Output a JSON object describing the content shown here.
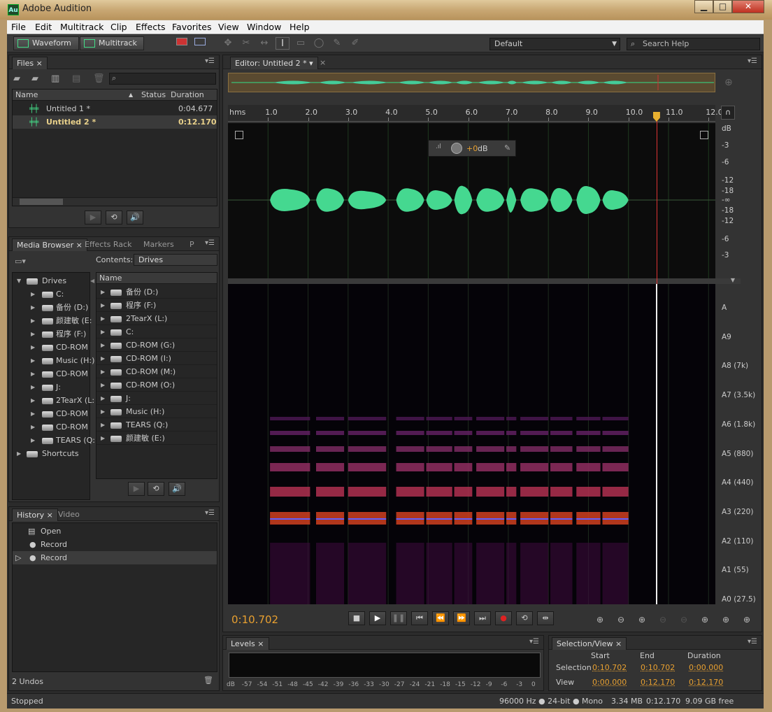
{
  "window": {
    "icon_label": "Au",
    "title": "Adobe Audition",
    "buttons": {
      "minimize": "▁",
      "maximize": "□",
      "close": "✕"
    }
  },
  "menu": [
    "File",
    "Edit",
    "Multitrack",
    "Clip",
    "Effects",
    "Favorites",
    "View",
    "Window",
    "Help"
  ],
  "toolbar": {
    "waveform_label": "Waveform",
    "multitrack_label": "Multitrack",
    "workspace_value": "Default",
    "search_placeholder": "Search Help"
  },
  "files_panel": {
    "tab": "Files",
    "columns": {
      "name": "Name",
      "status": "Status",
      "duration": "Duration"
    },
    "files": [
      {
        "name": "Untitled 1 *",
        "duration": "0:04.677"
      },
      {
        "name": "Untitled 2 *",
        "duration": "0:12.170"
      }
    ]
  },
  "media_panel": {
    "tabs": [
      "Media Browser",
      "Effects Rack",
      "Markers",
      "P"
    ],
    "contents_label": "Contents:",
    "contents_value": "Drives",
    "tree": [
      "Drives",
      "C:",
      "备份 (D:)",
      "颜建敏 (E:",
      "程序 (F:)",
      "CD-ROM",
      "Music (H:)",
      "CD-ROM",
      "J:",
      "2TearX (L:",
      "CD-ROM",
      "CD-ROM",
      "TEARS (Q:",
      "Shortcuts"
    ],
    "list_header": "Name",
    "list": [
      "备份 (D:)",
      "程序 (F:)",
      "2TearX (L:)",
      "C:",
      "CD-ROM (G:)",
      "CD-ROM (I:)",
      "CD-ROM (M:)",
      "CD-ROM (O:)",
      "J:",
      "Music (H:)",
      "TEARS (Q:)",
      "颜建敏 (E:)"
    ]
  },
  "history_panel": {
    "tabs": [
      "History",
      "Video"
    ],
    "items": [
      "Open",
      "Record",
      "Record"
    ],
    "undos": "2 Undos"
  },
  "editor": {
    "tab": "Editor: Untitled 2 *",
    "time_unit": "hms",
    "ticks": [
      "1.0",
      "2.0",
      "3.0",
      "4.0",
      "5.0",
      "6.0",
      "7.0",
      "8.0",
      "9.0",
      "10.0",
      "11.0",
      "12.0"
    ],
    "db_scale": [
      "dB",
      "-3",
      "-6",
      "-12",
      "-18",
      "-∞",
      "-18",
      "-12",
      "-6",
      "-3"
    ],
    "hud_gain": "+0",
    "hud_unit": "dB",
    "pitch_scale": [
      "A",
      "A9",
      "A8 (7k)",
      "A7 (3.5k)",
      "A6 (1.8k)",
      "A5 (880)",
      "A4 (440)",
      "A3 (220)",
      "A2 (110)",
      "A1 (55)",
      "A0 (27.5)"
    ],
    "current_time": "0:10.702",
    "playhead_seconds": 10.702,
    "total_seconds": 12.17
  },
  "levels_panel": {
    "tab": "Levels",
    "scale": [
      "dB",
      "-57",
      "-54",
      "-51",
      "-48",
      "-45",
      "-42",
      "-39",
      "-36",
      "-33",
      "-30",
      "-27",
      "-24",
      "-21",
      "-18",
      "-15",
      "-12",
      "-9",
      "-6",
      "-3",
      "0"
    ]
  },
  "selection_panel": {
    "tab": "Selection/View",
    "headers": {
      "start": "Start",
      "end": "End",
      "duration": "Duration"
    },
    "selection": {
      "label": "Selection",
      "start": "0:10.702",
      "end": "0:10.702",
      "duration": "0:00.000"
    },
    "view": {
      "label": "View",
      "start": "0:00.000",
      "end": "0:12.170",
      "duration": "0:12.170"
    }
  },
  "status_bar": {
    "state": "Stopped",
    "format": "96000 Hz ● 24-bit ● Mono",
    "size": "3.34 MB",
    "duration": "0:12.170",
    "free": "9.09 GB free"
  }
}
